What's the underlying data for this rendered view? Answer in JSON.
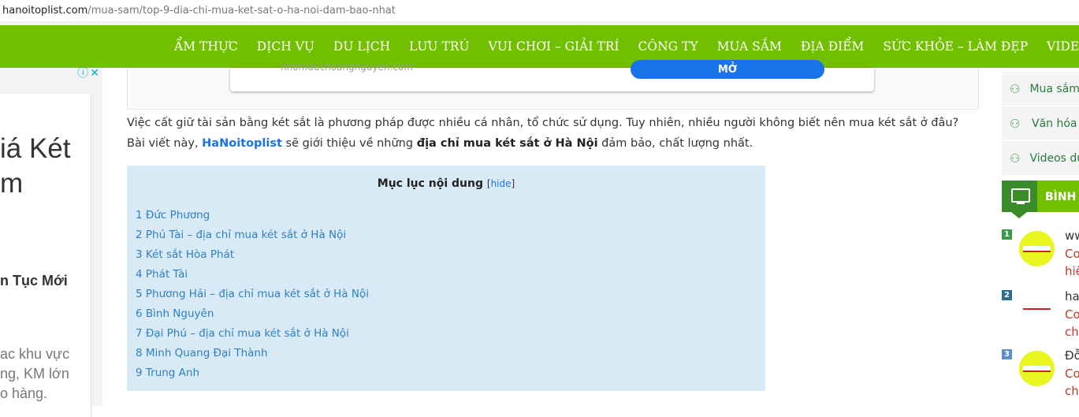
{
  "url": {
    "domain": "hanoitoplist.com",
    "path": "/mua-sam/top-9-dia-chi-mua-ket-sat-o-ha-noi-dam-bao-nhat"
  },
  "nav": {
    "items": [
      "ẨM THỰC",
      "DỊCH VỤ",
      "DU LỊCH",
      "LƯU TRÚ",
      "VUI CHƠI – GIẢI TRÍ",
      "CÔNG TY",
      "MUA SẮM",
      "ĐỊA ĐIỂM",
      "SỨC KHỎE – LÀM ĐẸP",
      "VIDEOS"
    ]
  },
  "colors": {
    "nav_bg": "#72bf00",
    "toc_bg": "#d9eaf7",
    "link": "#2e7fc0",
    "accent_green": "#3a8c2a"
  },
  "ad_left": {
    "line1": "iá Két",
    "line2": "m",
    "sub": "n Tục Mới",
    "desc1": "ac khu vực",
    "desc2": "ng, KM lớn",
    "desc3": "o hàng.",
    "controls": "ⓘ✕"
  },
  "top_ad": {
    "site": "nhomduchoangnguyen.com",
    "button": "MỞ"
  },
  "intro": {
    "text1": "Việc cất giữ tài sản bằng két sắt là phương pháp được nhiều cá nhân, tổ chức sử dụng. Tuy nhiên, nhiều người không biết nên mua két sắt ở đâu? Bài viết này,",
    "brand": "HaNoitoplist",
    "text2": " sẽ giới thiệu về những ",
    "bold": "địa chỉ mua két sắt ở Hà Nội",
    "text3": " đảm bảo, chất lượng nhất."
  },
  "toc": {
    "title": "Mục lục nội dung",
    "hide_open": "[",
    "hide": "hide",
    "hide_close": "]",
    "items": [
      "1 Đức Phương",
      "2 Phú Tài – địa chỉ mua két sắt ở Hà Nội",
      "3 Két sắt Hòa Phát",
      "4 Phát Tài",
      "5 Phương Hải – địa chỉ mua két sắt ở Hà Nội",
      "6 Bình Nguyên",
      "7 Đại Phú – địa chỉ mua két sắt ở Hà Nội",
      "8 Minh Quang Đại Thành",
      "9 Trung Anh"
    ]
  },
  "sidebar": {
    "links": [
      "Mua sắm",
      "Văn hóa",
      "Videos du"
    ],
    "section_title": "BÌNH L",
    "ranks": [
      {
        "num": "1",
        "num_color": "#3a9a4a",
        "author": "ww",
        "line1": "Co",
        "line2": "hiệ"
      },
      {
        "num": "2",
        "num_color": "#2e6e8e",
        "author": "ha",
        "line1": "Co",
        "line2": "chu"
      },
      {
        "num": "3",
        "num_color": "#5b8fc7",
        "author": "Đỗ",
        "line1": "Co",
        "line2": "chă"
      }
    ]
  }
}
